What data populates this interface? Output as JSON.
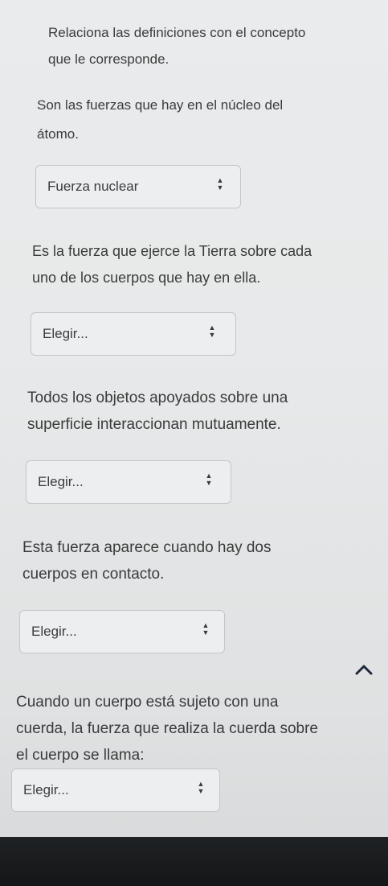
{
  "intro": [
    "Relaciona las definiciones con el concepto",
    "que le corresponde."
  ],
  "questions": [
    {
      "lines": [
        "Son las fuerzas que hay en el núcleo del",
        "átomo."
      ],
      "selected": "Fuerza nuclear"
    },
    {
      "lines": [
        "Es la fuerza que ejerce la Tierra sobre cada",
        "uno de los cuerpos que hay en ella."
      ],
      "selected": "Elegir..."
    },
    {
      "lines": [
        "Todos los objetos apoyados sobre una",
        "superficie interaccionan mutuamente."
      ],
      "selected": "Elegir..."
    },
    {
      "lines": [
        "Esta fuerza aparece cuando hay dos",
        "cuerpos en contacto."
      ],
      "selected": "Elegir..."
    },
    {
      "lines": [
        "Cuando un cuerpo está sujeto con una",
        "cuerda, la fuerza que realiza la cuerda sobre",
        "el cuerpo se llama:"
      ],
      "selected": "Elegir..."
    }
  ],
  "icons": {
    "select_arrows": "up-down-arrows-icon",
    "scroll_top": "chevron-up-icon"
  },
  "colors": {
    "background": "#e7e9ea",
    "text": "#3b3b3b",
    "select_border": "#c3c6c8"
  }
}
